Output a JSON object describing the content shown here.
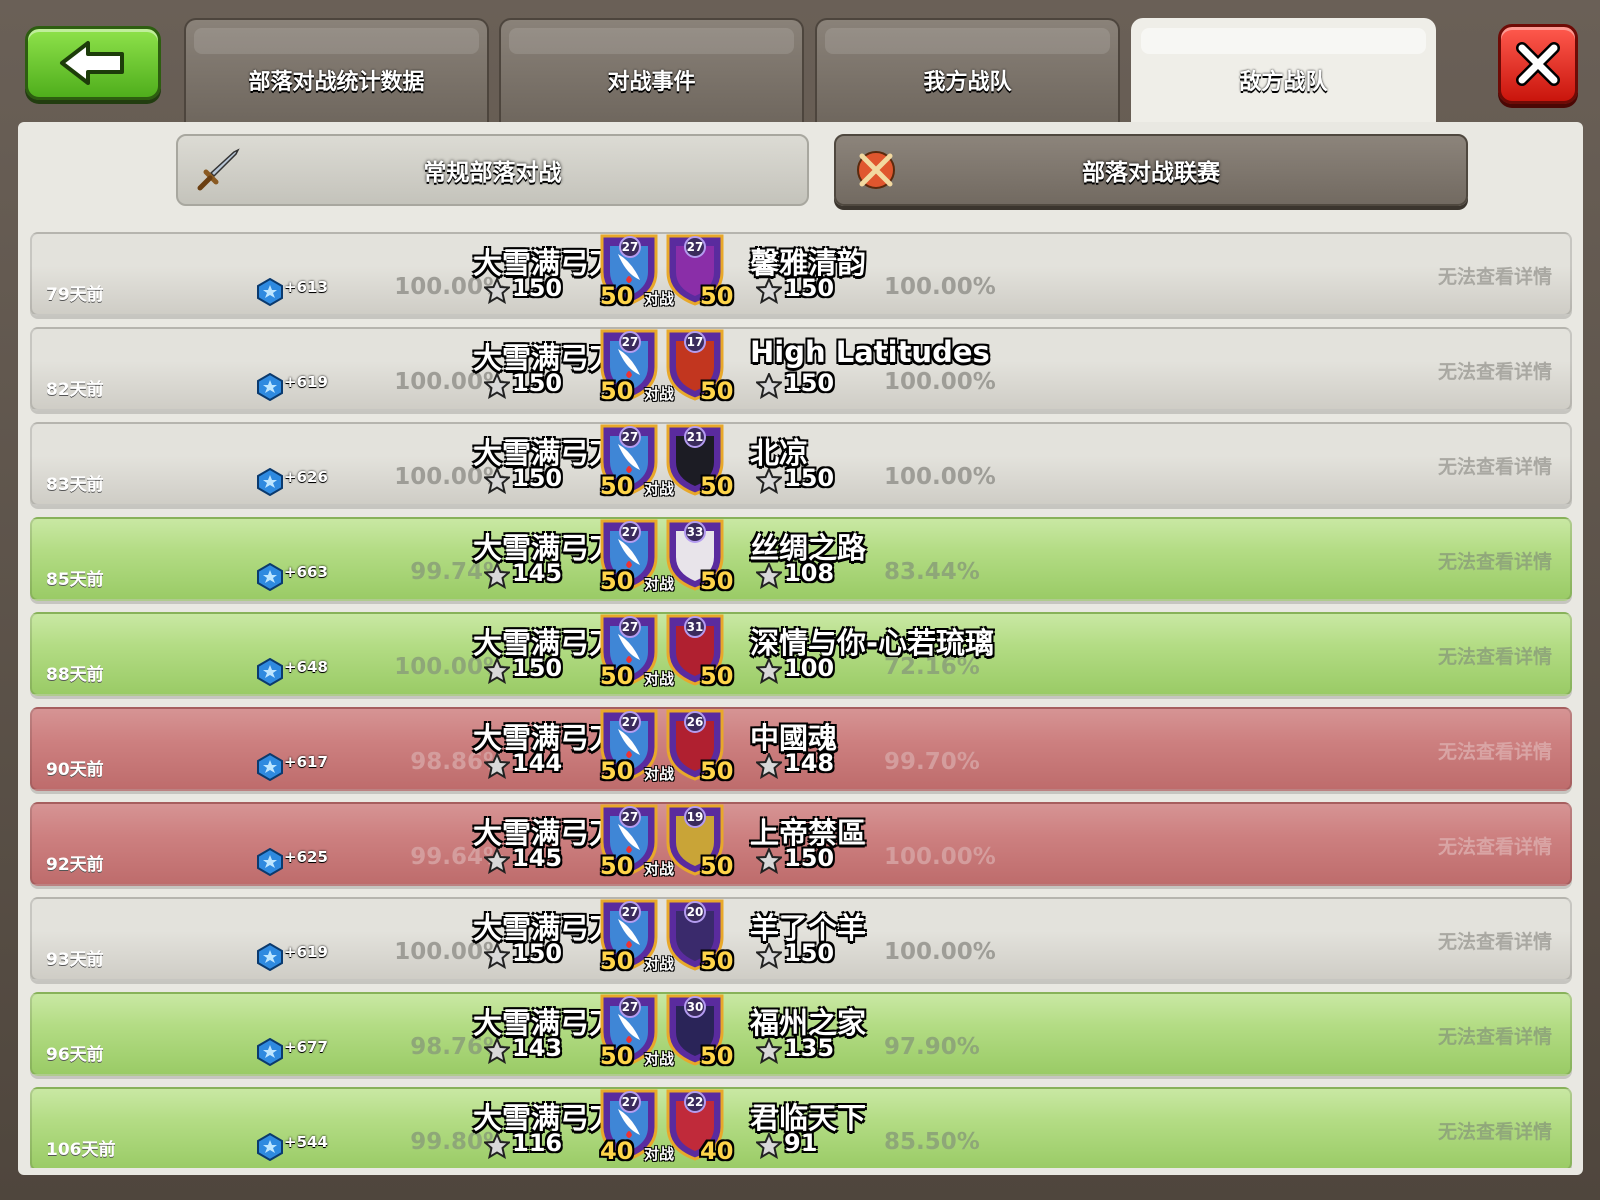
{
  "tabs": [
    "部落对战统计数据",
    "对战事件",
    "我方战队",
    "敌方战队"
  ],
  "active_tab": 3,
  "subtabs": {
    "regular": "常规部落对战",
    "league": "部落对战联赛"
  },
  "vs_label": "对战",
  "details_label": "无法查看详情",
  "wars": [
    {
      "ago": "79天前",
      "xp": "+613",
      "my_name": "大雪满弓刀",
      "my_pct": "100.00%",
      "my_stars": "150",
      "my_size": "50",
      "my_level": "27",
      "enemy_name": "馨雅清韵",
      "enemy_pct": "100.00%",
      "enemy_stars": "150",
      "enemy_size": "50",
      "enemy_level": "27",
      "result": "neutral",
      "enemy_badge_color": "#8a2ea8"
    },
    {
      "ago": "82天前",
      "xp": "+619",
      "my_name": "大雪满弓刀",
      "my_pct": "100.00%",
      "my_stars": "150",
      "my_size": "50",
      "my_level": "27",
      "enemy_name": "High Latitudes",
      "enemy_pct": "100.00%",
      "enemy_stars": "150",
      "enemy_size": "50",
      "enemy_level": "17",
      "result": "neutral",
      "enemy_badge_color": "#c2361f"
    },
    {
      "ago": "83天前",
      "xp": "+626",
      "my_name": "大雪满弓刀",
      "my_pct": "100.00%",
      "my_stars": "150",
      "my_size": "50",
      "my_level": "27",
      "enemy_name": "北凉",
      "enemy_pct": "100.00%",
      "enemy_stars": "150",
      "enemy_size": "50",
      "enemy_level": "21",
      "result": "neutral",
      "enemy_badge_color": "#1c1c24"
    },
    {
      "ago": "85天前",
      "xp": "+663",
      "my_name": "大雪满弓刀",
      "my_pct": "99.74%",
      "my_stars": "145",
      "my_size": "50",
      "my_level": "27",
      "enemy_name": "丝绸之路",
      "enemy_pct": "83.44%",
      "enemy_stars": "108",
      "enemy_size": "50",
      "enemy_level": "33",
      "result": "win",
      "enemy_badge_color": "#e8e4ea"
    },
    {
      "ago": "88天前",
      "xp": "+648",
      "my_name": "大雪满弓刀",
      "my_pct": "100.00%",
      "my_stars": "150",
      "my_size": "50",
      "my_level": "27",
      "enemy_name": "深情与你-心若琉璃",
      "enemy_pct": "72.16%",
      "enemy_stars": "100",
      "enemy_size": "50",
      "enemy_level": "31",
      "result": "win",
      "enemy_badge_color": "#b02030"
    },
    {
      "ago": "90天前",
      "xp": "+617",
      "my_name": "大雪满弓刀",
      "my_pct": "98.86%",
      "my_stars": "144",
      "my_size": "50",
      "my_level": "27",
      "enemy_name": "中國魂",
      "enemy_pct": "99.70%",
      "enemy_stars": "148",
      "enemy_size": "50",
      "enemy_level": "26",
      "result": "loss",
      "enemy_badge_color": "#b02030"
    },
    {
      "ago": "92天前",
      "xp": "+625",
      "my_name": "大雪满弓刀",
      "my_pct": "99.64%",
      "my_stars": "145",
      "my_size": "50",
      "my_level": "27",
      "enemy_name": "上帝禁區",
      "enemy_pct": "100.00%",
      "enemy_stars": "150",
      "enemy_size": "50",
      "enemy_level": "19",
      "result": "loss",
      "enemy_badge_color": "#c9a437"
    },
    {
      "ago": "93天前",
      "xp": "+619",
      "my_name": "大雪满弓刀",
      "my_pct": "100.00%",
      "my_stars": "150",
      "my_size": "50",
      "my_level": "27",
      "enemy_name": "羊了个羊",
      "enemy_pct": "100.00%",
      "enemy_stars": "150",
      "enemy_size": "50",
      "enemy_level": "20",
      "result": "neutral",
      "enemy_badge_color": "#3a2a6c"
    },
    {
      "ago": "96天前",
      "xp": "+677",
      "my_name": "大雪满弓刀",
      "my_pct": "98.76%",
      "my_stars": "143",
      "my_size": "50",
      "my_level": "27",
      "enemy_name": "福州之家",
      "enemy_pct": "97.90%",
      "enemy_stars": "135",
      "enemy_size": "50",
      "enemy_level": "30",
      "result": "win",
      "enemy_badge_color": "#2a2458"
    },
    {
      "ago": "106天前",
      "xp": "+544",
      "my_name": "大雪满弓刀",
      "my_pct": "99.80%",
      "my_stars": "116",
      "my_size": "40",
      "my_level": "27",
      "enemy_name": "君临天下",
      "enemy_pct": "85.50%",
      "enemy_stars": "91",
      "enemy_size": "40",
      "enemy_level": "22",
      "result": "win",
      "enemy_badge_color": "#c02a3a"
    }
  ],
  "colors": {
    "win": "#a8d478",
    "loss": "#cd8080",
    "neutral": "#dcdbd5",
    "accent_gold": "#ffd54a"
  }
}
